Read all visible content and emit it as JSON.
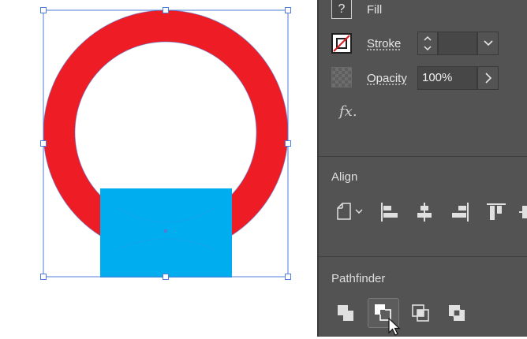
{
  "appearance": {
    "fill": {
      "label": "Fill",
      "swatch_glyph": "?"
    },
    "stroke": {
      "label": "Stroke",
      "value": ""
    },
    "opacity": {
      "label": "Opacity",
      "value": "100%"
    },
    "fx_glyph": "fx."
  },
  "align": {
    "title": "Align",
    "icons": [
      "align-to-selection-icon",
      "align-left-edges-icon",
      "align-horizontal-centers-icon",
      "align-right-edges-icon",
      "align-top-edges-icon",
      "align-more-icon"
    ]
  },
  "pathfinder": {
    "title": "Pathfinder",
    "icons": [
      "pathfinder-add-icon",
      "pathfinder-subtract-icon",
      "pathfinder-intersect-icon",
      "pathfinder-exclude-overlap-icon"
    ],
    "active_index": 1
  },
  "colors": {
    "ring": "#ee1c25",
    "rectangle": "#00aeef",
    "selection": "#4f7bd9",
    "panel_bg": "#535353"
  }
}
